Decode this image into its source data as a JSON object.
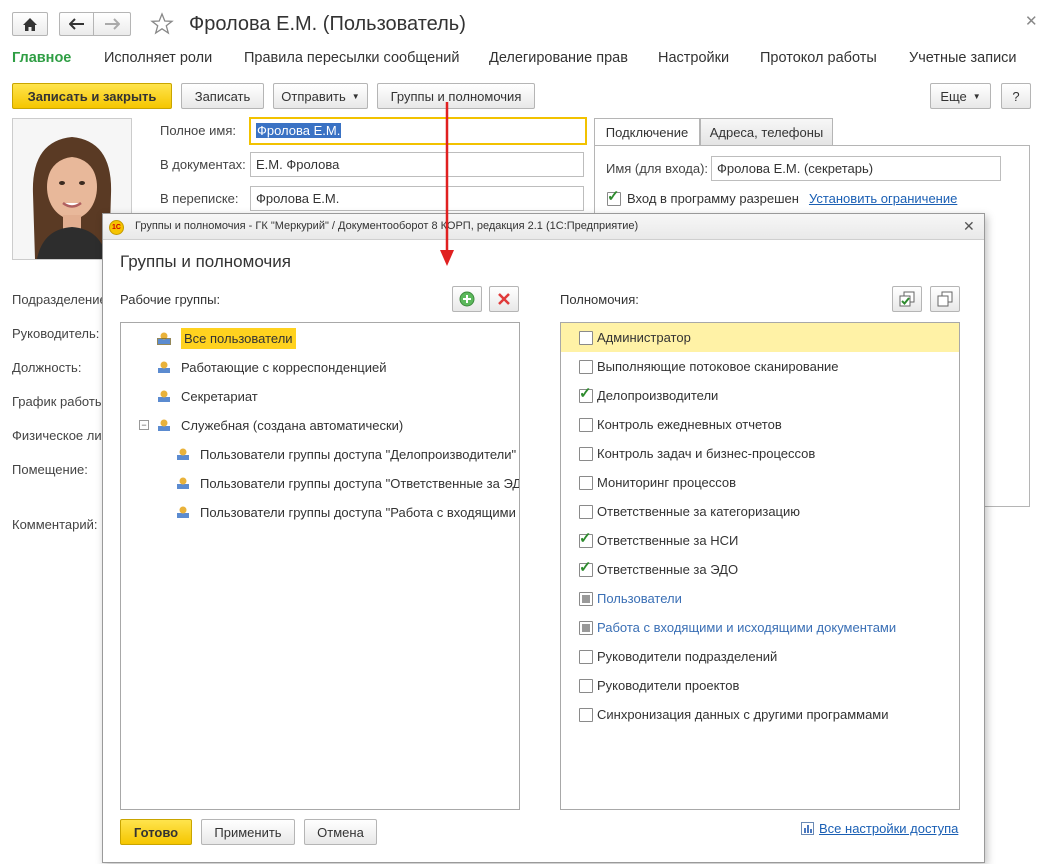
{
  "window": {
    "title": "Фролова Е.М. (Пользователь)"
  },
  "tabs": [
    "Главное",
    "Исполняет роли",
    "Правила пересылки сообщений",
    "Делегирование прав",
    "Настройки",
    "Протокол работы",
    "Учетные записи"
  ],
  "toolbar": {
    "save_close": "Записать и закрыть",
    "save": "Записать",
    "send": "Отправить",
    "groups": "Группы и полномочия",
    "more": "Еще",
    "help": "?"
  },
  "form": {
    "fullname_label": "Полное имя:",
    "fullname_value": "Фролова Е.М.",
    "docs_label": "В документах:",
    "docs_value": "Е.М. Фролова",
    "corr_label": "В переписке:",
    "corr_value": "Фролова Е.М.",
    "left_labels": [
      "Подразделение",
      "Руководитель:",
      "Должность:",
      "График работы:",
      "Физическое ли",
      "Помещение:",
      "Комментарий:"
    ]
  },
  "right_panel": {
    "tabs": [
      "Подключение",
      "Адреса, телефоны"
    ],
    "login_label": "Имя (для входа):",
    "login_value": "Фролова Е.М. (секретарь)",
    "login_allowed": "Вход в программу разрешен",
    "set_limit": "Установить ограничение"
  },
  "dialog": {
    "window_title": "Группы и полномочия - ГК \"Меркурий\" / Документооборот 8 КОРП, редакция 2.1  (1С:Предприятие)",
    "heading": "Группы и полномочия",
    "groups_label": "Рабочие группы:",
    "perms_label": "Полномочия:",
    "groups": [
      {
        "label": "Все пользователи",
        "level": 0,
        "selected": true
      },
      {
        "label": "Работающие с корреспонденцией",
        "level": 0
      },
      {
        "label": "Секретариат",
        "level": 0
      },
      {
        "label": "Служебная (создана автоматически)",
        "level": 0,
        "expanded": true
      },
      {
        "label": "Пользователи группы доступа \"Делопроизводители\"",
        "level": 1
      },
      {
        "label": "Пользователи группы доступа \"Ответственные за ЭДО\"",
        "level": 1
      },
      {
        "label": "Пользователи группы доступа \"Работа с входящими и исходящими документами\"",
        "level": 1
      }
    ],
    "permissions": [
      {
        "label": "Администратор",
        "state": "off",
        "highlight": true
      },
      {
        "label": "Выполняющие потоковое сканирование",
        "state": "off"
      },
      {
        "label": "Делопроизводители",
        "state": "on"
      },
      {
        "label": "Контроль ежедневных отчетов",
        "state": "off"
      },
      {
        "label": "Контроль задач и бизнес-процессов",
        "state": "off"
      },
      {
        "label": "Мониторинг процессов",
        "state": "off"
      },
      {
        "label": "Ответственные за категоризацию",
        "state": "off"
      },
      {
        "label": "Ответственные за НСИ",
        "state": "on"
      },
      {
        "label": "Ответственные за ЭДО",
        "state": "on"
      },
      {
        "label": "Пользователи",
        "state": "partial"
      },
      {
        "label": "Работа с входящими и исходящими документами",
        "state": "partial"
      },
      {
        "label": "Руководители подразделений",
        "state": "off"
      },
      {
        "label": "Руководители проектов",
        "state": "off"
      },
      {
        "label": "Синхронизация данных с другими программами",
        "state": "off"
      }
    ],
    "ok": "Готово",
    "apply": "Применить",
    "cancel": "Отмена",
    "all_settings": "Все настройки доступа"
  },
  "colors": {
    "accent_green": "#2f9e44",
    "yellow": "#f5c600",
    "selection": "#ffe15a",
    "link": "#1a5fb4",
    "arrow": "#e02020"
  }
}
